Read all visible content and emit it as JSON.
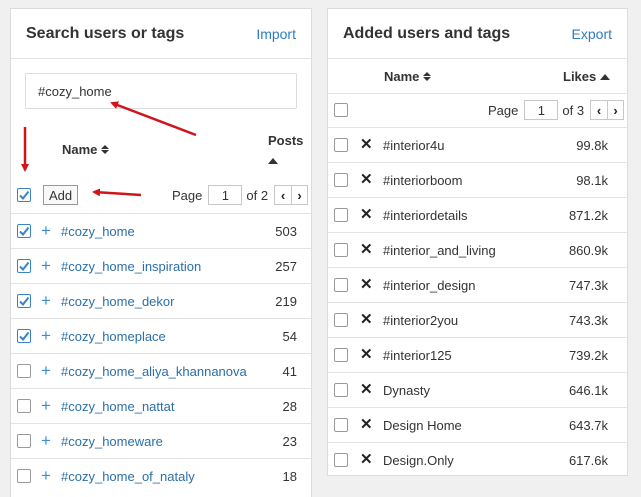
{
  "left": {
    "title": "Search users or tags",
    "import_label": "Import",
    "search_value": "#cozy_home",
    "col_name": "Name",
    "col_posts": "Posts",
    "add_label": "Add",
    "page_label": "Page",
    "page_value": "1",
    "page_total": "of 2",
    "rows": [
      {
        "tag": "#cozy_home",
        "posts": "503",
        "checked": true
      },
      {
        "tag": "#cozy_home_inspiration",
        "posts": "257",
        "checked": true
      },
      {
        "tag": "#cozy_home_dekor",
        "posts": "219",
        "checked": true
      },
      {
        "tag": "#cozy_homeplace",
        "posts": "54",
        "checked": true
      },
      {
        "tag": "#cozy_home_aliya_khannanova",
        "posts": "41",
        "checked": false
      },
      {
        "tag": "#cozy_home_nattat",
        "posts": "28",
        "checked": false
      },
      {
        "tag": "#cozy_homeware",
        "posts": "23",
        "checked": false
      },
      {
        "tag": "#cozy_home_of_nataly",
        "posts": "18",
        "checked": false
      }
    ]
  },
  "right": {
    "title": "Added users and tags",
    "export_label": "Export",
    "col_name": "Name",
    "col_likes": "Likes",
    "page_label": "Page",
    "page_value": "1",
    "page_total": "of 3",
    "rows": [
      {
        "tag": "#interior4u",
        "likes": "99.8k"
      },
      {
        "tag": "#interiorboom",
        "likes": "98.1k"
      },
      {
        "tag": "#interiordetails",
        "likes": "871.2k"
      },
      {
        "tag": "#interior_and_living",
        "likes": "860.9k"
      },
      {
        "tag": "#interior_design",
        "likes": "747.3k"
      },
      {
        "tag": "#interior2you",
        "likes": "743.3k"
      },
      {
        "tag": "#interior125",
        "likes": "739.2k"
      },
      {
        "tag": "Dynasty",
        "likes": "646.1k"
      },
      {
        "tag": "Design Home",
        "likes": "643.7k"
      },
      {
        "tag": "Design.Only",
        "likes": "617.6k"
      }
    ]
  },
  "colors": {
    "accent": "#2f7ebf",
    "annotation_arrow": "#d0141a",
    "checkbox": "#3b83c4"
  },
  "icons": {
    "plus": "plus-icon",
    "remove": "close-icon",
    "sort": "sort-icon",
    "prev": "chevron-left-icon",
    "next": "chevron-right-icon"
  }
}
